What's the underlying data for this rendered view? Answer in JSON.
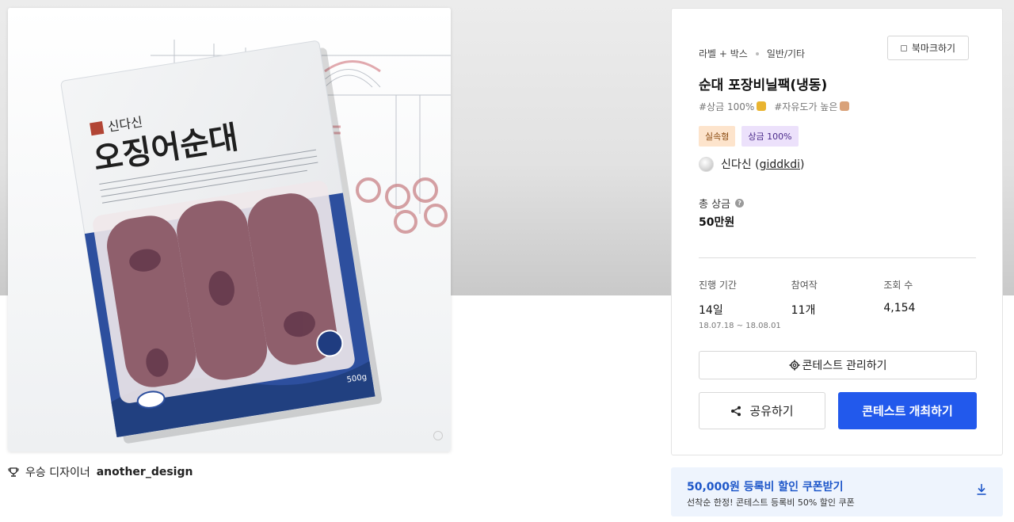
{
  "colors": {
    "accent": "#2259ec",
    "coupon_text": "#1e57c9",
    "badge_orange_bg": "#fde4cc",
    "badge_purple_bg": "#ece1fb"
  },
  "image": {
    "package_brand": "신다신",
    "package_title": "오징어순대",
    "package_weight": "500g"
  },
  "designer": {
    "prefix": "우승 디자이너",
    "name": "another_design",
    "icon": "trophy-icon"
  },
  "info": {
    "category": "라벨 + 박스",
    "subcategory": "일반/기타",
    "bookmark_label": "북마크하기",
    "title": "순대 포장비닐팩(냉동)",
    "tags": [
      "#상금 100%",
      "#자유도가 높은"
    ],
    "badges": [
      "실속형",
      "상금 100%"
    ],
    "host_name": "신다신 (",
    "host_id": "giddkdi",
    "host_close": ")",
    "prize_label": "총 상금",
    "prize_value": "50만원",
    "stats": [
      {
        "label": "진행 기간",
        "value": "14일",
        "sub": "18.07.18 ~ 18.08.01"
      },
      {
        "label": "참여작",
        "value": "11개",
        "sub": ""
      },
      {
        "label": "조회 수",
        "value": "4,154",
        "sub": ""
      }
    ],
    "manage_label": "콘테스트 관리하기",
    "share_label": "공유하기",
    "host_contest_label": "콘테스트 개최하기"
  },
  "coupon": {
    "title": "50,000원 등록비 할인 쿠폰받기",
    "subtitle": "선착순 한정! 콘테스트 등록비 50% 할인 쿠폰",
    "icon": "download-icon"
  }
}
